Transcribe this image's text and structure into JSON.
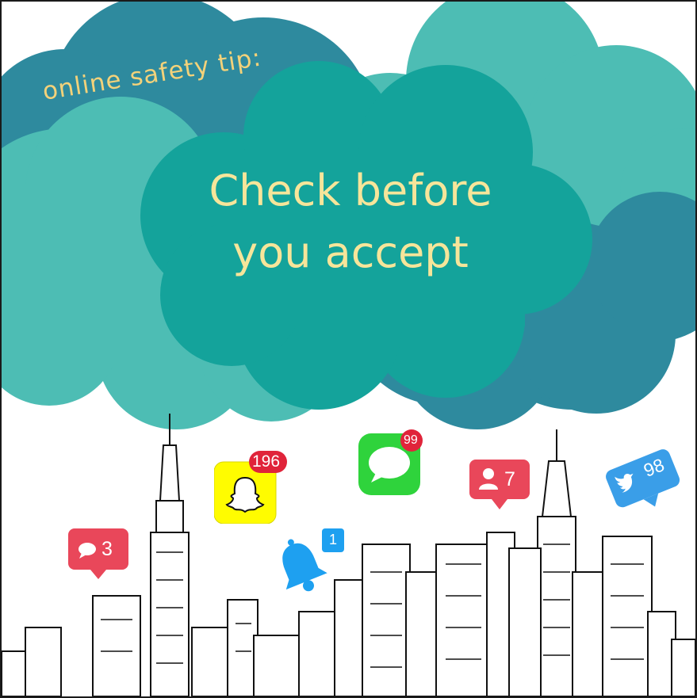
{
  "tip_label": "online safety tip:",
  "headline": {
    "line1": "Check before",
    "line2": "you accept"
  },
  "notifications": {
    "comments": {
      "icon": "comment-icon",
      "count": "3"
    },
    "snapchat": {
      "icon": "snapchat-ghost-icon",
      "count": "196"
    },
    "bell": {
      "icon": "bell-icon",
      "count": "1"
    },
    "messages": {
      "icon": "message-bubble-icon",
      "count": "99"
    },
    "friends": {
      "icon": "user-icon",
      "count": "7"
    },
    "twitter": {
      "icon": "twitter-bird-icon",
      "count": "98"
    }
  },
  "colors": {
    "cloud_dark": "#2e8a9e",
    "cloud_light": "#4dbdb4",
    "cloud_center": "#14a39b",
    "text_yellow": "#f6e59a",
    "badge_red": "#e0243a",
    "pin_red": "#e9475a",
    "snapchat_yellow": "#fffc00",
    "messages_green": "#2fd33c",
    "bell_blue": "#1ea0f0",
    "twitter_blue": "#3a9ee8"
  }
}
